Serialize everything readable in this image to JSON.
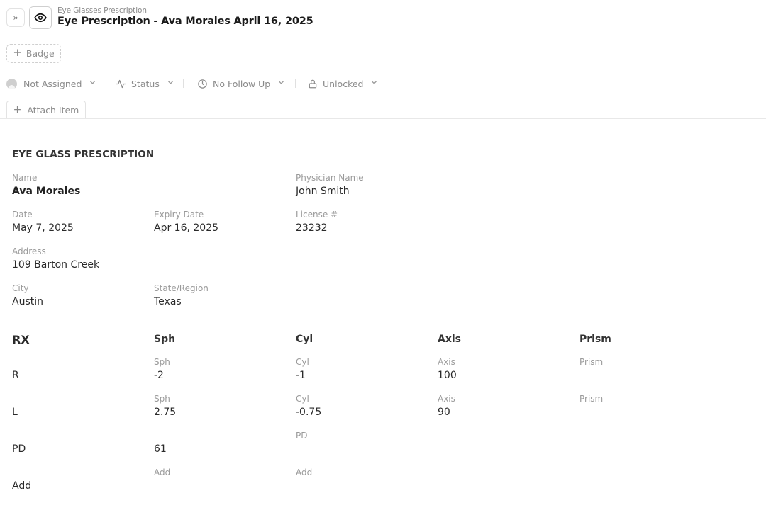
{
  "header": {
    "breadcrumb": "Eye Glasses Prescription",
    "title": "Eye Prescription - Ava Morales April 16, 2025",
    "expand_glyph": "»",
    "view_icon": "eye-icon"
  },
  "badge": {
    "label": "Badge",
    "plus": "+"
  },
  "toolbar": {
    "assignee": "Not Assigned",
    "status": "Status",
    "follow_up": "No Follow Up",
    "lock": "Unlocked",
    "chevron": "⌄"
  },
  "attach": {
    "label": "Attach Item",
    "plus": "+"
  },
  "prescription": {
    "section_title": "EYE GLASS PRESCRIPTION",
    "name_label": "Name",
    "name_value": "Ava Morales",
    "physician_label": "Physician Name",
    "physician_value": "John Smith",
    "date_label": "Date",
    "date_value": "May 7, 2025",
    "expiry_label": "Expiry Date",
    "expiry_value": "Apr 16, 2025",
    "license_label": "License #",
    "license_value": "23232",
    "address_label": "Address",
    "address_value": "109 Barton Creek",
    "city_label": "City",
    "city_value": "Austin",
    "state_label": "State/Region",
    "state_value": "Texas"
  },
  "rx": {
    "title": "RX",
    "columns": [
      "Sph",
      "Cyl",
      "Axis",
      "Prism"
    ],
    "right": {
      "label": "R",
      "sph_label": "Sph",
      "sph": "-2",
      "cyl_label": "Cyl",
      "cyl": "-1",
      "axis_label": "Axis",
      "axis": "100",
      "prism_label": "Prism"
    },
    "left": {
      "label": "L",
      "sph_label": "Sph",
      "sph": "2.75",
      "cyl_label": "Cyl",
      "cyl": "-0.75",
      "axis_label": "Axis",
      "axis": "90",
      "prism_label": "Prism"
    },
    "pd": {
      "label": "PD",
      "value": "61",
      "pd_label": "PD"
    },
    "add": {
      "label": "Add",
      "add_label_1": "Add",
      "add_label_2": "Add"
    }
  }
}
